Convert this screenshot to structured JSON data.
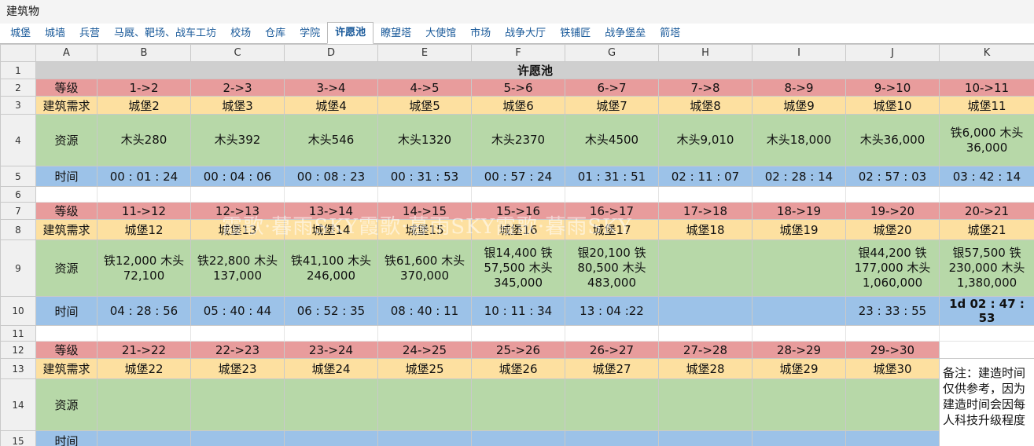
{
  "window_title": "建筑物",
  "tabs": [
    "城堡",
    "城墙",
    "兵营",
    "马厩、靶场、战车工坊",
    "校场",
    "仓库",
    "学院",
    "许愿池",
    "瞭望塔",
    "大使馆",
    "市场",
    "战争大厅",
    "铁铺匠",
    "战争堡垒",
    "箭塔"
  ],
  "active_tab": "许愿池",
  "columns": [
    "A",
    "B",
    "C",
    "D",
    "E",
    "F",
    "G",
    "H",
    "I",
    "J",
    "K"
  ],
  "sheet_title": "许愿池",
  "labels": {
    "level": "等级",
    "req": "建筑需求",
    "res": "资源",
    "time": "时间"
  },
  "blocks": [
    {
      "levels": [
        "1->2",
        "2->3",
        "3->4",
        "4->5",
        "5->6",
        "6->7",
        "7->8",
        "8->9",
        "9->10",
        "10->11"
      ],
      "req": [
        "城堡2",
        "城堡3",
        "城堡4",
        "城堡5",
        "城堡6",
        "城堡7",
        "城堡8",
        "城堡9",
        "城堡10",
        "城堡11"
      ],
      "res": [
        "木头280",
        "木头392",
        "木头546",
        "木头1320",
        "木头2370",
        "木头4500",
        "木头9,010",
        "木头18,000",
        "木头36,000",
        "铁6,000 木头\n36,000"
      ],
      "time": [
        "00 : 01 : 24",
        "00 : 04 : 06",
        "00 : 08 : 23",
        "00 : 31 : 53",
        "00 : 57 : 24",
        "01 : 31 : 51",
        "02 : 11 : 07",
        "02 : 28 : 14",
        "02 : 57 : 03",
        "03 : 42 : 14"
      ]
    },
    {
      "levels": [
        "11->12",
        "12->13",
        "13->14",
        "14->15",
        "15->16",
        "16->17",
        "17->18",
        "18->19",
        "19->20",
        "20->21"
      ],
      "req": [
        "城堡12",
        "城堡13",
        "城堡14",
        "城堡15",
        "城堡16",
        "城堡17",
        "城堡18",
        "城堡19",
        "城堡20",
        "城堡21"
      ],
      "res": [
        "铁12,000 木头\n72,100",
        "铁22,800 木头\n137,000",
        "铁41,100 木头\n246,000",
        "铁61,600 木头\n370,000",
        "银14,400 铁\n57,500 木头\n345,000",
        "银20,100 铁\n80,500 木头\n483,000",
        "",
        "",
        "银44,200 铁\n177,000 木头\n1,060,000",
        "银57,500 铁\n230,000 木头\n1,380,000"
      ],
      "time": [
        "04 : 28 : 56",
        "05 : 40 : 44",
        "06 : 52 : 35",
        "08 : 40 : 11",
        "10 : 11 : 34",
        "13 : 04 :22",
        "",
        "",
        "23 : 33 : 55",
        "1d 02 : 47 : 53"
      ]
    },
    {
      "levels": [
        "21->22",
        "22->23",
        "23->24",
        "24->25",
        "25->26",
        "26->27",
        "27->28",
        "28->29",
        "29->30"
      ],
      "req": [
        "城堡22",
        "城堡23",
        "城堡24",
        "城堡25",
        "城堡26",
        "城堡27",
        "城堡28",
        "城堡29",
        "城堡30"
      ],
      "res": [
        "",
        "",
        "",
        "",
        "",
        "",
        "",
        "",
        ""
      ],
      "time": [
        "",
        "",
        "",
        "",
        "",
        "",
        "",
        "",
        ""
      ]
    }
  ],
  "note": "备注：建造时间仅供参考，因为建造时间会因每人科技升级程度",
  "watermark": "霞歌·暮雨SKY霞歌·暮雨SKY霞歌·暮雨SKY",
  "colors": {
    "level": "#e89c9c",
    "req": "#fde0a0",
    "res": "#b7d8a8",
    "time": "#9cc2e8",
    "header": "#cfcfcf"
  }
}
